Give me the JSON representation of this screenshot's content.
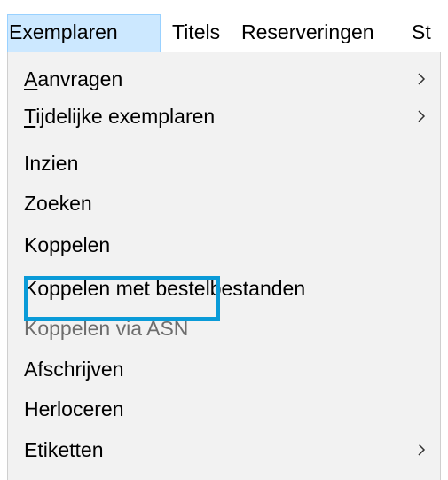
{
  "menubar": {
    "items": [
      {
        "label": "Exemplaren"
      },
      {
        "label": "Titels"
      },
      {
        "label": "Reserveringen"
      },
      {
        "label": "St"
      }
    ]
  },
  "menu": {
    "items": [
      {
        "prefix": "A",
        "rest": "anvragen",
        "submenu": true
      },
      {
        "prefix": "T",
        "rest": "ijdelijke exemplaren",
        "submenu": true
      },
      {
        "label": "Inzien"
      },
      {
        "label": "Zoeken"
      },
      {
        "label": "Koppelen",
        "highlighted": true
      },
      {
        "label": "Koppelen met bestelbestanden"
      },
      {
        "label": "Koppelen via ASN",
        "disabled": true
      },
      {
        "label": "Afschrijven"
      },
      {
        "label": "Herloceren"
      },
      {
        "label": "Etiketten",
        "submenu": true
      }
    ]
  },
  "colors": {
    "open_menu_bg": "#cce8ff",
    "dropdown_bg": "#f2f2f2",
    "highlight_border": "#0a9bd8",
    "disabled_text": "#6d6d6d"
  }
}
